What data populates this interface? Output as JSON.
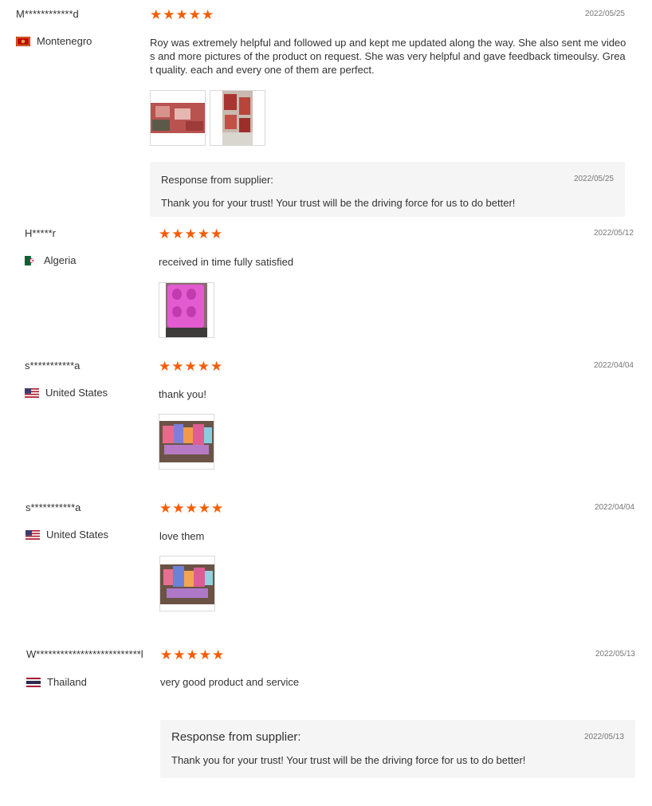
{
  "reviews": [
    {
      "username": "M************d",
      "country": "Montenegro",
      "flag_icon": "montenegro-flag-icon",
      "stars": "★★★★★",
      "rating": 5,
      "date": "2022/05/25",
      "text": "Roy was extremely helpful and followed up and kept me updated along the way. She also sent me videos and more pictures of the product on request. She was very helpful and gave feedback timeoulsy. Great quality. each and every one of them are perfect.",
      "photos": [
        "photo",
        "photo"
      ],
      "response": {
        "title": "Response from supplier:",
        "date": "2022/05/25",
        "text": "Thank you for your trust! Your trust will be the driving force for us to do better!"
      }
    },
    {
      "username": "H*****r",
      "country": "Algeria",
      "flag_icon": "algeria-flag-icon",
      "stars": "★★★★★",
      "rating": 5,
      "date": "2022/05/12",
      "text": "received in time fully satisfied",
      "photos": [
        "photo"
      ]
    },
    {
      "username": "s***********a",
      "country": "United States",
      "flag_icon": "us-flag-icon",
      "stars": "★★★★★",
      "rating": 5,
      "date": "2022/04/04",
      "text": "thank you!",
      "photos": [
        "photo"
      ]
    },
    {
      "username": "s***********a",
      "country": "United States",
      "flag_icon": "us-flag-icon",
      "stars": "★★★★★",
      "rating": 5,
      "date": "2022/04/04",
      "text": "love them",
      "photos": [
        "photo"
      ]
    },
    {
      "username": "W**************************l",
      "country": "Thailand",
      "flag_icon": "thailand-flag-icon",
      "stars": "★★★★★",
      "rating": 5,
      "date": "2022/05/13",
      "text": "very good product and service",
      "response": {
        "title": "Response from supplier:",
        "date": "2022/05/13",
        "text": "Thank you for your trust! Your trust will be the driving force for us to do better!"
      }
    }
  ],
  "colors": {
    "star": "#f45d08",
    "response_bg": "#f5f5f5"
  }
}
